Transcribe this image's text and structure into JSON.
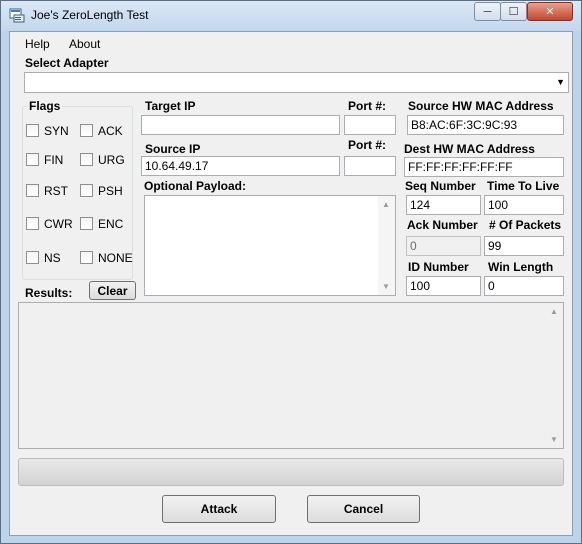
{
  "window": {
    "title": "Joe's ZeroLength Test",
    "controls": {
      "minimize": "─",
      "maximize": "☐",
      "close": "✕"
    }
  },
  "menu": {
    "items": [
      "Help",
      "About"
    ]
  },
  "adapter": {
    "label": "Select Adapter",
    "value": ""
  },
  "flags": {
    "label": "Flags",
    "items": [
      "SYN",
      "ACK",
      "FIN",
      "URG",
      "RST",
      "PSH",
      "CWR",
      "ENC",
      "NS",
      "NONE"
    ]
  },
  "target": {
    "target_ip_label": "Target IP",
    "target_ip_value": "",
    "target_port_label": "Port #:",
    "target_port_value": "",
    "source_ip_label": "Source IP",
    "source_ip_value": "10.64.49.17",
    "source_port_label": "Port #:",
    "source_port_value": "",
    "payload_label": "Optional Payload:",
    "payload_value": ""
  },
  "mac": {
    "source_label": "Source HW MAC Address",
    "source_value": "B8:AC:6F:3C:9C:93",
    "dest_label": "Dest HW MAC Address",
    "dest_value": "FF:FF:FF:FF:FF:FF"
  },
  "params": {
    "seq_label": "Seq Number",
    "seq_value": "124",
    "ttl_label": "Time To Live",
    "ttl_value": "100",
    "ack_label": "Ack Number",
    "ack_value": "0",
    "packets_label": "# Of Packets",
    "packets_value": "99",
    "id_label": "ID Number",
    "id_value": "100",
    "win_label": "Win Length",
    "win_value": "0"
  },
  "results": {
    "label": "Results:",
    "clear_label": "Clear",
    "text": ""
  },
  "progress": {
    "value": 0
  },
  "actions": {
    "attack_label": "Attack",
    "cancel_label": "Cancel"
  }
}
